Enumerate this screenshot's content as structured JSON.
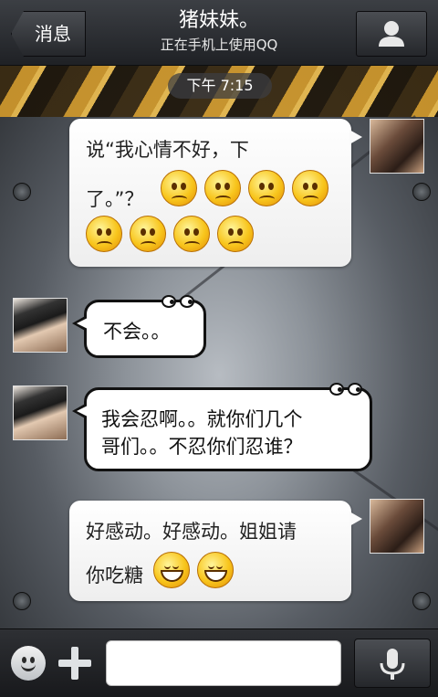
{
  "header": {
    "back_label": "消息",
    "title": "猪妹妹。",
    "subtitle": "正在手机上使用QQ"
  },
  "chat": {
    "timestamp": "下午 7:15",
    "messages": [
      {
        "sender": "self",
        "lines": [
          "说“我心情不好，下",
          "了。”？"
        ],
        "emoji": "worried",
        "emoji_count": 8
      },
      {
        "sender": "other",
        "lines": [
          "不会。。"
        ]
      },
      {
        "sender": "other",
        "lines": [
          "我会忍啊。。就你们几个",
          "哥们。。不忍你们忍谁？"
        ]
      },
      {
        "sender": "self",
        "lines": [
          "好感动。好感动。姐姐请",
          "你吃糖"
        ],
        "emoji": "grin",
        "emoji_count": 2
      }
    ]
  },
  "input": {
    "placeholder": "",
    "value": ""
  },
  "icons": {
    "back": "back-arrow-icon",
    "profile": "person-icon",
    "emoji": "smiley-icon",
    "plus": "plus-icon",
    "voice": "microphone-icon"
  }
}
